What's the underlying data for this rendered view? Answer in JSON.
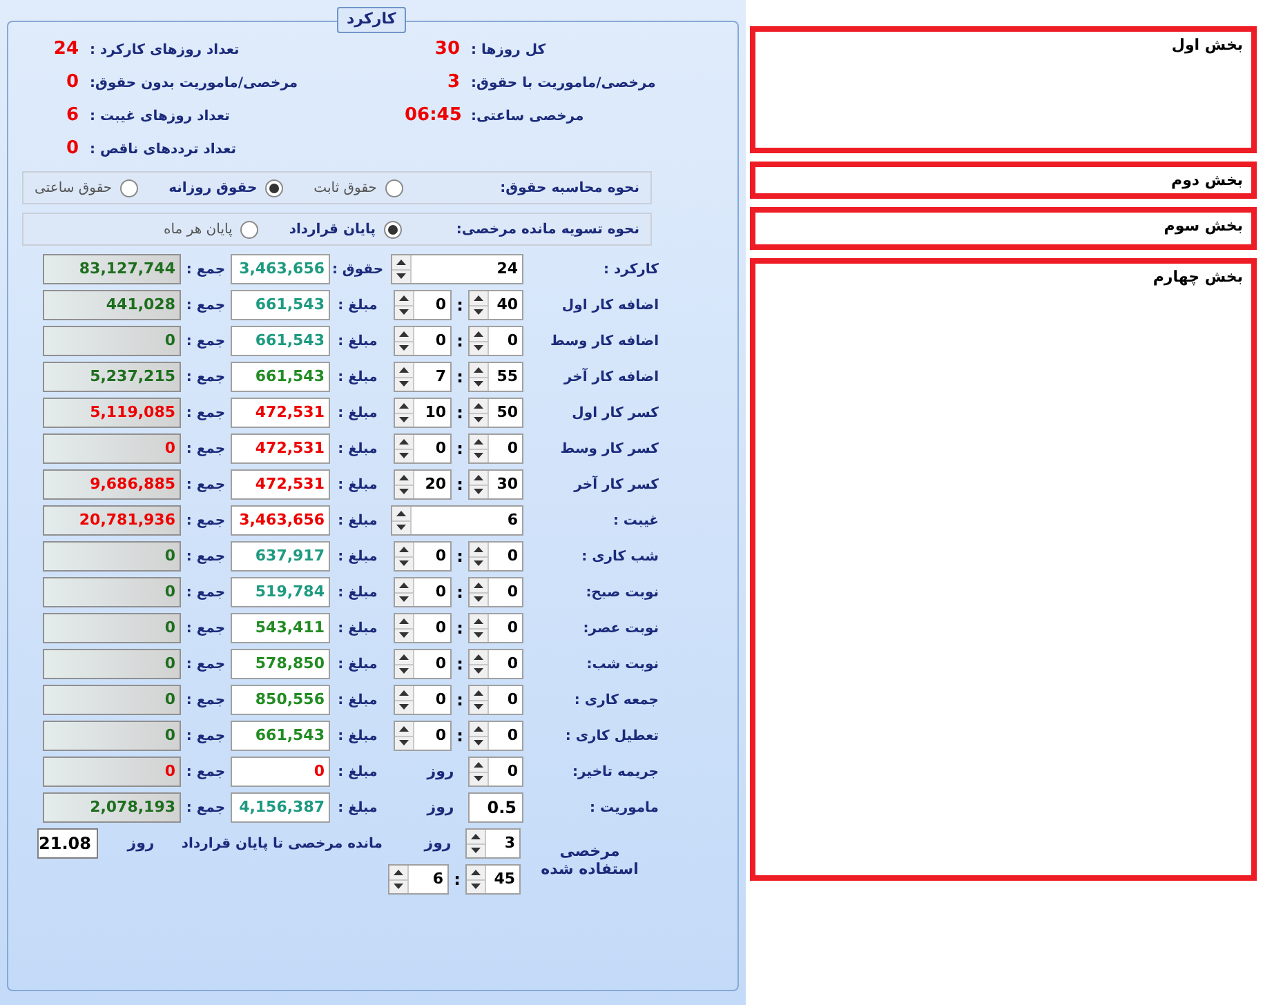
{
  "panel": {
    "legend": "کارکرد"
  },
  "summary_rows": [
    {
      "right": {
        "label": "کل روزها :",
        "value": "30"
      },
      "left": {
        "label": "تعداد روزهای کارکرد :",
        "value": "24"
      }
    },
    {
      "right": {
        "label": "مرخصی/ماموریت با حقوق:",
        "value": "3"
      },
      "left": {
        "label": "مرخصی/ماموریت بدون حقوق:",
        "value": "0"
      }
    },
    {
      "right": {
        "label": "مرخصی ساعتی:",
        "value": "06:45"
      },
      "left": {
        "label": "تعداد روزهای غیبت :",
        "value": "6"
      }
    },
    {
      "left": {
        "label": "تعداد ترددهای ناقص :",
        "value": "0"
      }
    }
  ],
  "salary_method": {
    "label": "نحوه محاسبه حقوق:",
    "options": [
      {
        "label": "حقوق ثابت",
        "selected": false
      },
      {
        "label": "حقوق روزانه",
        "selected": true
      },
      {
        "label": "حقوق ساعتی",
        "selected": false
      }
    ]
  },
  "leave_settlement": {
    "label": "نحوه تسویه مانده مرخصی:",
    "options": [
      {
        "label": "پایان قرارداد",
        "selected": true
      },
      {
        "label": "پایان هر ماه",
        "selected": false
      }
    ]
  },
  "rows": [
    {
      "kind": "single",
      "label": "کارکرد :",
      "value": "24",
      "amount_label": "حقوق :",
      "amount": {
        "text": "3,463,656",
        "color": "#1e9a80"
      },
      "total_label": "جمع :",
      "total": {
        "text": "83,127,744",
        "color": "#1e6e1e"
      }
    },
    {
      "kind": "time",
      "label": "اضافه کار اول",
      "hours": "40",
      "sep": ":",
      "minutes": "0",
      "amount_label": "مبلغ :",
      "amount": {
        "text": "661,543",
        "color": "#1e9a80"
      },
      "total_label": "جمع :",
      "total": {
        "text": "441,028",
        "color": "#1e6e1e"
      }
    },
    {
      "kind": "time",
      "label": "اضافه کار وسط",
      "hours": "0",
      "sep": ":",
      "minutes": "0",
      "amount_label": "مبلغ :",
      "amount": {
        "text": "661,543",
        "color": "#1e9a80"
      },
      "total_label": "جمع :",
      "total": {
        "text": "0",
        "color": "#1e6e1e"
      }
    },
    {
      "kind": "time",
      "label": "اضافه کار آخر",
      "hours": "55",
      "sep": ":",
      "minutes": "7",
      "amount_label": "مبلغ :",
      "amount": {
        "text": "661,543",
        "color": "#228b22"
      },
      "total_label": "جمع :",
      "total": {
        "text": "5,237,215",
        "color": "#1e6e1e"
      }
    },
    {
      "kind": "time",
      "label": "کسر کار اول",
      "hours": "50",
      "sep": ":",
      "minutes": "10",
      "amount_label": "مبلغ :",
      "amount": {
        "text": "472,531",
        "color": "#ee0000"
      },
      "total_label": "جمع :",
      "total": {
        "text": "5,119,085",
        "color": "#ee0000"
      }
    },
    {
      "kind": "time",
      "label": "کسر کار وسط",
      "hours": "0",
      "sep": ":",
      "minutes": "0",
      "amount_label": "مبلغ :",
      "amount": {
        "text": "472,531",
        "color": "#ee0000"
      },
      "total_label": "جمع :",
      "total": {
        "text": "0",
        "color": "#ee0000"
      }
    },
    {
      "kind": "time",
      "label": "کسر کار آخر",
      "hours": "30",
      "sep": ":",
      "minutes": "20",
      "amount_label": "مبلغ :",
      "amount": {
        "text": "472,531",
        "color": "#ee0000"
      },
      "total_label": "جمع :",
      "total": {
        "text": "9,686,885",
        "color": "#ee0000"
      }
    },
    {
      "kind": "single",
      "label": "غیبت :",
      "value": "6",
      "amount_label": "مبلغ :",
      "amount": {
        "text": "3,463,656",
        "color": "#ee0000"
      },
      "total_label": "جمع :",
      "total": {
        "text": "20,781,936",
        "color": "#ee0000"
      }
    },
    {
      "kind": "time",
      "label": "شب کاری :",
      "hours": "0",
      "sep": ":",
      "minutes": "0",
      "amount_label": "مبلغ :",
      "amount": {
        "text": "637,917",
        "color": "#1e9a80"
      },
      "total_label": "جمع :",
      "total": {
        "text": "0",
        "color": "#1e6e1e"
      }
    },
    {
      "kind": "time",
      "label": "نوبت صبح:",
      "hours": "0",
      "sep": ":",
      "minutes": "0",
      "amount_label": "مبلغ :",
      "amount": {
        "text": "519,784",
        "color": "#1e9a80"
      },
      "total_label": "جمع :",
      "total": {
        "text": "0",
        "color": "#1e6e1e"
      }
    },
    {
      "kind": "time",
      "label": "نوبت عصر:",
      "hours": "0",
      "sep": ":",
      "minutes": "0",
      "amount_label": "مبلغ :",
      "amount": {
        "text": "543,411",
        "color": "#228b22"
      },
      "total_label": "جمع :",
      "total": {
        "text": "0",
        "color": "#1e6e1e"
      }
    },
    {
      "kind": "time",
      "label": "نوبت شب:",
      "hours": "0",
      "sep": ":",
      "minutes": "0",
      "amount_label": "مبلغ :",
      "amount": {
        "text": "578,850",
        "color": "#228b22"
      },
      "total_label": "جمع :",
      "total": {
        "text": "0",
        "color": "#1e6e1e"
      }
    },
    {
      "kind": "time",
      "label": "جمعه کاری :",
      "hours": "0",
      "sep": ":",
      "minutes": "0",
      "amount_label": "مبلغ :",
      "amount": {
        "text": "850,556",
        "color": "#228b22"
      },
      "total_label": "جمع :",
      "total": {
        "text": "0",
        "color": "#1e6e1e"
      }
    },
    {
      "kind": "time",
      "label": "تعطیل کاری :",
      "hours": "0",
      "sep": ":",
      "minutes": "0",
      "amount_label": "مبلغ :",
      "amount": {
        "text": "661,543",
        "color": "#228b22"
      },
      "total_label": "جمع :",
      "total": {
        "text": "0",
        "color": "#1e6e1e"
      }
    },
    {
      "kind": "days_spin",
      "label": "جریمه تاخیر:",
      "value": "0",
      "unit": "روز",
      "amount_label": "مبلغ :",
      "amount": {
        "text": "0",
        "color": "#ee0000"
      },
      "total_label": "جمع :",
      "total": {
        "text": "0",
        "color": "#ee0000"
      }
    },
    {
      "kind": "days_input",
      "label": "ماموریت :",
      "value": "0.5",
      "unit": "روز",
      "amount_label": "مبلغ :",
      "amount": {
        "text": "4,156,387",
        "color": "#1e9a80"
      },
      "total_label": "جمع :",
      "total": {
        "text": "2,078,193",
        "color": "#1e6e1e"
      }
    }
  ],
  "leave_used": {
    "label": "مرخصی استفاده شده",
    "days": "3",
    "unit": "روز",
    "hours": "45",
    "sep": ":",
    "minutes": "6"
  },
  "leave_remaining": {
    "label": "مانده مرخصی تا پایان قرارداد",
    "unit": "روز",
    "value": "21.08"
  },
  "sections": [
    {
      "title": "بخش اول"
    },
    {
      "title": "بخش دوم"
    },
    {
      "title": "بخش سوم"
    },
    {
      "title": "بخش چهارم"
    }
  ]
}
